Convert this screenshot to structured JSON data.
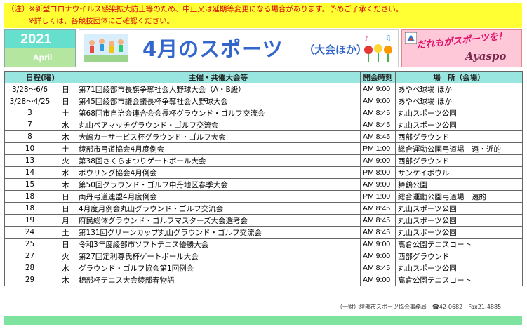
{
  "notice": {
    "line1": "（注）※新型コロナウイルス感染拡大防止等のため、中止又は延期等変更になる場合があります。予めご了承ください。",
    "line2": "※詳しくは、各競技団体にご確認ください。"
  },
  "header": {
    "year": "2021",
    "month": "April",
    "title": "4月のスポーツ",
    "subtitle": "（大会ほか）",
    "tagline": "だれもがスポーツを！",
    "brand": "Ayaspo"
  },
  "table": {
    "columns": [
      "日程(曜)",
      "主催・共催大会等",
      "開会時刻",
      "場　所（会場）"
    ],
    "rows": [
      {
        "date": "3/28～6/6",
        "day": "日",
        "event": "第71回綾部市長旗争奪社会人野球大会（A・B級）",
        "time": "AM 9:00",
        "venue": "あやべ球場 ほか"
      },
      {
        "date": "3/28～4/25",
        "day": "日",
        "event": "第45回綾部市議会議長杯争奪社会人野球大会",
        "time": "AM 9:00",
        "venue": "あやべ球場 ほか"
      },
      {
        "date": "3",
        "day": "土",
        "event": "第68回市自治会連合会会長杯グラウンド・ゴルフ交流会",
        "time": "AM 8:45",
        "venue": "丸山スポーツ公園"
      },
      {
        "date": "7",
        "day": "水",
        "event": "丸山ペアマッチグラウンド・ゴルフ交流会",
        "time": "AM 8:45",
        "venue": "丸山スポーツ公園"
      },
      {
        "date": "8",
        "day": "木",
        "event": "大嶋カーサービス杯グラウンド・ゴルフ大会",
        "time": "AM 8:45",
        "venue": "西部グラウンド"
      },
      {
        "date": "10",
        "day": "土",
        "event": "綾部市弓道協会4月度例会",
        "time": "PM 1:00",
        "venue": "総合運動公園弓道場　遠・近的"
      },
      {
        "date": "13",
        "day": "火",
        "event": "第38回さくらまつりゲートボール大会",
        "time": "AM 9:00",
        "venue": "西部グラウンド"
      },
      {
        "date": "14",
        "day": "水",
        "event": "ボウリング協会4月例会",
        "time": "PM 8:00",
        "venue": "サンケイボウル"
      },
      {
        "date": "15",
        "day": "木",
        "event": "第50回グラウンド・ゴルフ中丹地区春季大会",
        "time": "AM 9:00",
        "venue": "舞鶴公園"
      },
      {
        "date": "18",
        "day": "日",
        "event": "両丹弓道連盟4月度例会",
        "time": "PM 1:00",
        "venue": "総合運動公園弓道場　遠的"
      },
      {
        "date": "18",
        "day": "日",
        "event": "4月度月例会丸山グラウンド・ゴルフ交流会",
        "time": "AM 8:45",
        "venue": "丸山スポーツ公園"
      },
      {
        "date": "19",
        "day": "月",
        "event": "府民総体グラウンド・ゴルフマスターズ大会選考会",
        "time": "AM 8:45",
        "venue": "丸山スポーツ公園"
      },
      {
        "date": "24",
        "day": "土",
        "event": "第131回グリーンカップ丸山グラウンド・ゴルフ交流会",
        "time": "AM 8:45",
        "venue": "丸山スポーツ公園"
      },
      {
        "date": "25",
        "day": "日",
        "event": "令和3年度綾部市ソフトテニス優勝大会",
        "time": "AM 9:00",
        "venue": "高倉公園テニスコート"
      },
      {
        "date": "27",
        "day": "火",
        "event": "第27回定利尊氏杯ゲートボール大会",
        "time": "AM 9:00",
        "venue": "西部グラウンド"
      },
      {
        "date": "28",
        "day": "水",
        "event": "グラウンド・ゴルフ協会第1回例会",
        "time": "AM 8:45",
        "venue": "丸山スポーツ公園"
      },
      {
        "date": "29",
        "day": "木",
        "event": "錦部杯テニス大会綾部春物語",
        "time": "AM 9:00",
        "venue": "高倉公園テニスコート"
      }
    ]
  },
  "footer": "（一財）綾部市スポーツ協会事務局　☎42-0682　Fax21-4885",
  "colors": {
    "notice_bg": "#ffff33",
    "notice_text": "#d40000",
    "header_row_bg": "#99e6e0",
    "title_blue": "#3366cc",
    "logo_bg": "#ffc8d8",
    "bottom_bar": "#7fe3a0"
  }
}
